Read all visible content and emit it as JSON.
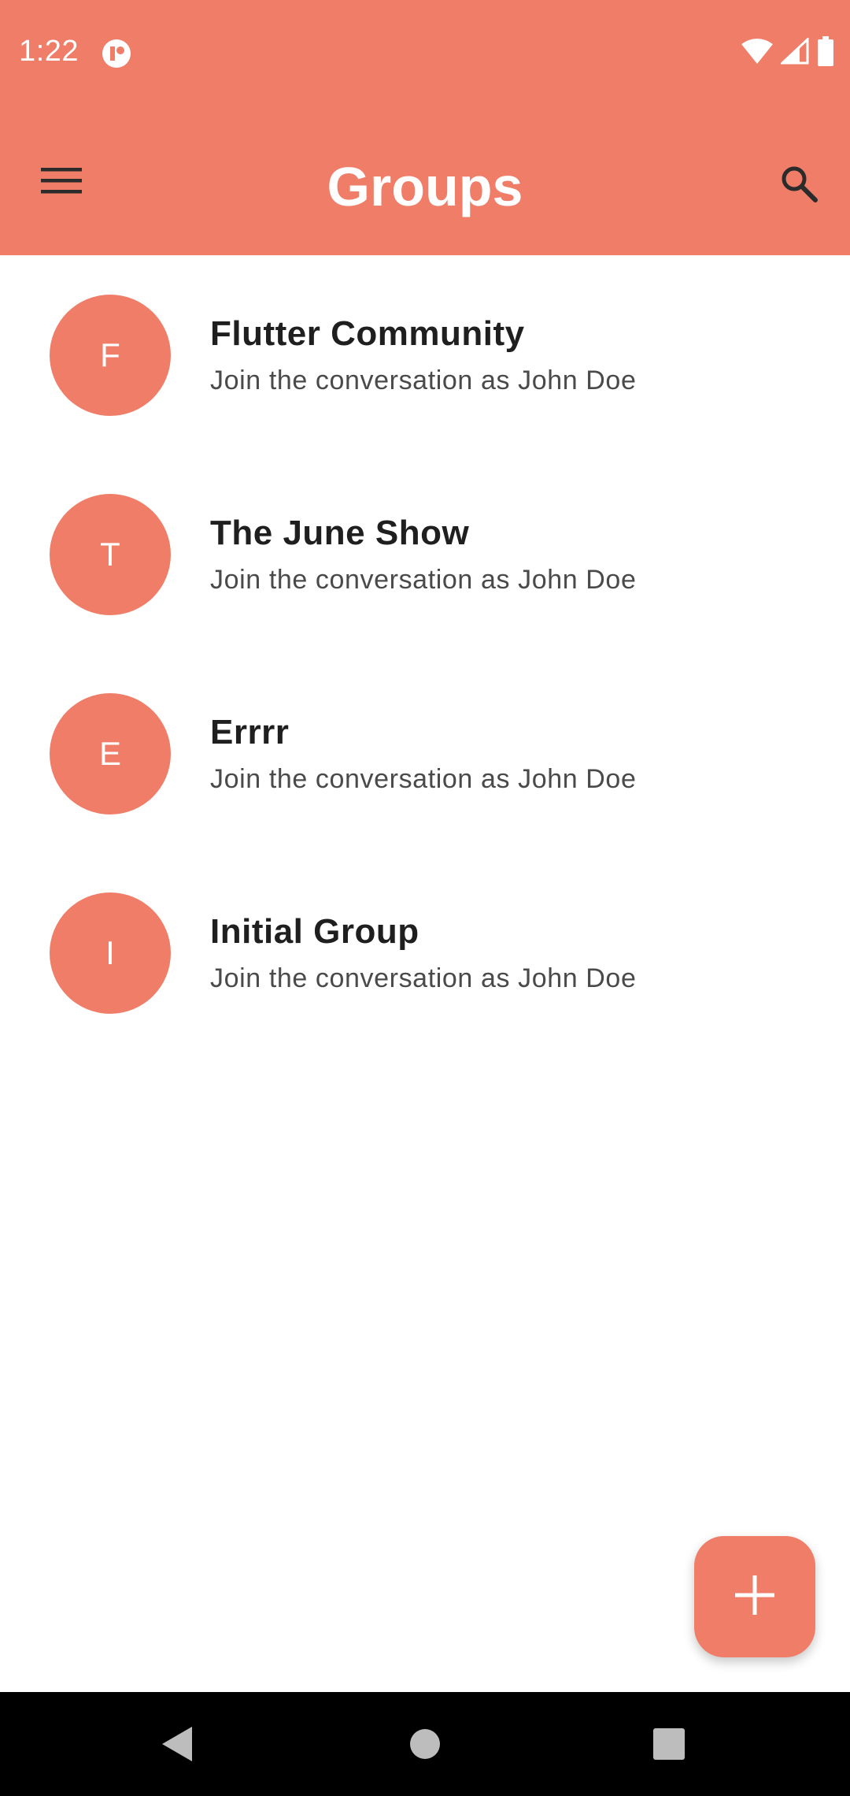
{
  "status_bar": {
    "time": "1:22",
    "icons": [
      "app-notification-icon",
      "wifi-icon",
      "cell-signal-icon",
      "battery-icon"
    ]
  },
  "app_bar": {
    "title": "Groups",
    "menu_icon": "hamburger-menu-icon",
    "search_icon": "search-icon"
  },
  "groups": [
    {
      "initial": "F",
      "title": "Flutter Community",
      "subtitle": "Join the conversation as John Doe"
    },
    {
      "initial": "T",
      "title": "The June Show",
      "subtitle": "Join the conversation as John Doe"
    },
    {
      "initial": "E",
      "title": "Errrr",
      "subtitle": "Join the conversation as John Doe"
    },
    {
      "initial": "I",
      "title": "Initial Group",
      "subtitle": "Join the conversation as John Doe"
    }
  ],
  "fab": {
    "icon": "add-icon"
  },
  "nav_bar": {
    "icons": [
      "back-icon",
      "home-icon",
      "recents-icon"
    ]
  },
  "colors": {
    "accent": "#EF7D68",
    "title_text": "#1f1f1f",
    "subtitle_text": "#4a4a4a",
    "nav_bar": "#000000"
  }
}
